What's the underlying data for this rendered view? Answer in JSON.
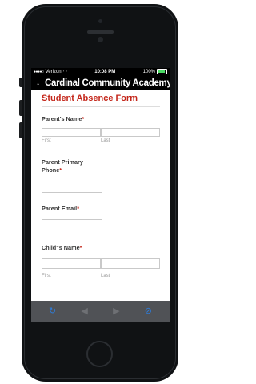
{
  "status_bar": {
    "carrier": "Verizon",
    "time": "10:08 PM",
    "battery": "100%"
  },
  "nav": {
    "back_icon": "down-arrow-icon",
    "title": "Cardinal Community Academy"
  },
  "form": {
    "title": "Student Absence Form",
    "required_marker": "*",
    "parent_name": {
      "label": "Parent's Name",
      "first_sub": "First",
      "last_sub": "Last"
    },
    "parent_phone": {
      "label_line1": "Parent Primary",
      "label_line2": "Phone"
    },
    "parent_email": {
      "label": "Parent Email"
    },
    "child_name": {
      "label": "Child\"s Name",
      "first_sub": "First",
      "last_sub": "Last"
    }
  },
  "toolbar": {
    "icons": [
      "refresh-icon",
      "back-arrow-icon",
      "forward-arrow-icon",
      "compass-icon"
    ]
  },
  "colors": {
    "accent_red": "#c4261a",
    "toolbar_blue": "#2f7bd6",
    "toolbar_bg": "#505256"
  }
}
